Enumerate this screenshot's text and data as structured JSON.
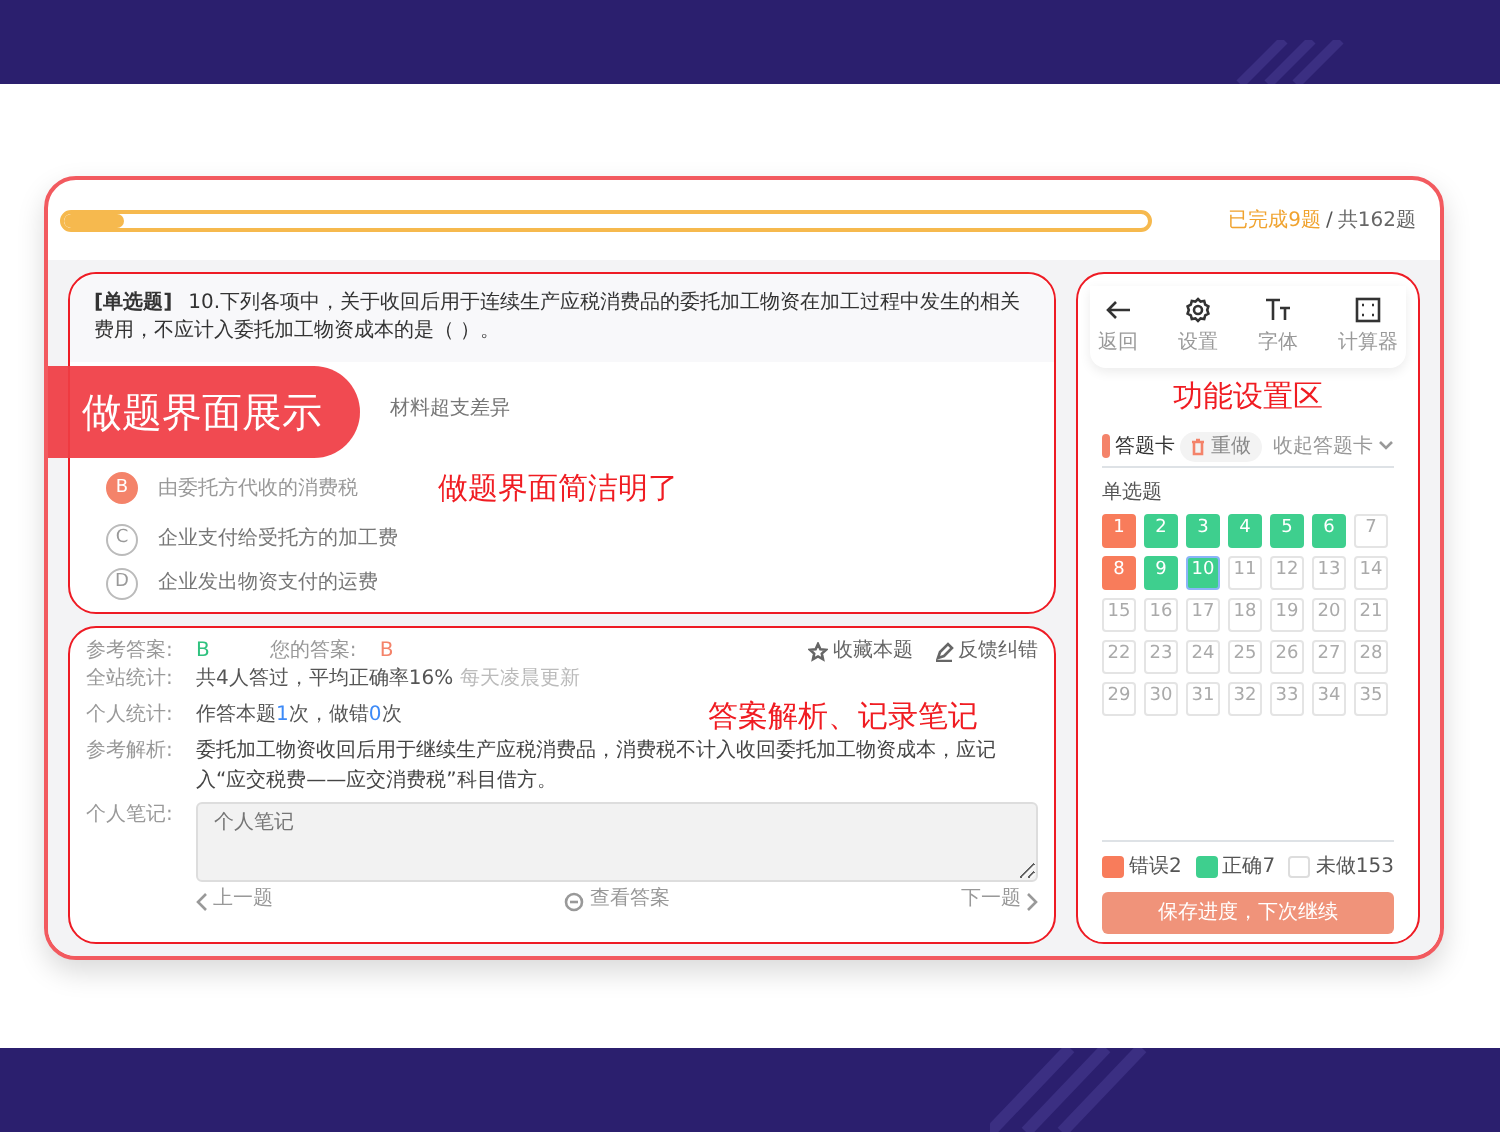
{
  "progress": {
    "level": 0.056,
    "done": "已完成9题",
    "separator": "/",
    "total": "共162题"
  },
  "question": {
    "type": "[单选题]",
    "text": "10.下列各项中，关于收回后用于连续生产应税消费品的委托加工物资在加工过程中发生的相关费用，不应计入委托加工物资成本的是（  ）。",
    "options": [
      {
        "text": "材料超支差异",
        "selected": false
      },
      {
        "letter": "B",
        "text": "由委托方代收的消费税",
        "selected": true
      },
      {
        "letter": "C",
        "text": "企业支付给受托方的加工费",
        "selected": false
      },
      {
        "letter": "D",
        "text": "企业发出物资支付的运费",
        "selected": false
      }
    ]
  },
  "answer": {
    "reference_label": "参考答案:",
    "reference": "B",
    "yours_label": "您的答案:",
    "yours": "B",
    "actions": [
      {
        "label": "收藏本题",
        "kind": "star"
      },
      {
        "label": "反馈纠错",
        "kind": "edit"
      }
    ],
    "site_stats_label": "全站统计:",
    "site_stats": "共4人答过，平均正确率16%",
    "site_stats_note": "每天凌晨更新",
    "personal_stats_label": "个人统计:",
    "personal_stats": [
      {
        "text": "作答本题",
        "highlight": false
      },
      {
        "text": "1",
        "highlight": true
      },
      {
        "text": "次，做错",
        "highlight": false
      },
      {
        "text": "0",
        "highlight": true
      },
      {
        "text": "次",
        "highlight": false
      }
    ],
    "analysis_label": "参考解析:",
    "analysis": "委托加工物资收回后用于继续生产应税消费品，消费税不计入收回委托加工物资成本，应记入“应交税费——应交消费税”科目借方。",
    "notes_label": "个人笔记:",
    "notes_placeholder": "个人笔记",
    "prev": "上一题",
    "show": "查看答案",
    "next": "下一题"
  },
  "tools": [
    {
      "label": "返回",
      "kind": "back"
    },
    {
      "label": "设置",
      "kind": "settings"
    },
    {
      "label": "字体",
      "kind": "font"
    },
    {
      "label": "计算器",
      "kind": "calculator"
    }
  ],
  "card_header": {
    "title": "答题卡",
    "redo": "重做",
    "collapse": "收起答题卡"
  },
  "section": "单选题",
  "cells": [
    {
      "n": "1",
      "kind": "wrong"
    },
    {
      "n": "2",
      "kind": "right"
    },
    {
      "n": "3",
      "kind": "right"
    },
    {
      "n": "4",
      "kind": "right"
    },
    {
      "n": "5",
      "kind": "right"
    },
    {
      "n": "6",
      "kind": "right"
    },
    {
      "n": "7",
      "kind": "undone"
    },
    {
      "n": "8",
      "kind": "wrong"
    },
    {
      "n": "9",
      "kind": "right"
    },
    {
      "n": "10",
      "kind": "current"
    },
    {
      "n": "11",
      "kind": "undone"
    },
    {
      "n": "12",
      "kind": "undone"
    },
    {
      "n": "13",
      "kind": "undone"
    },
    {
      "n": "14",
      "kind": "undone"
    },
    {
      "n": "15",
      "kind": "undone"
    },
    {
      "n": "16",
      "kind": "undone"
    },
    {
      "n": "17",
      "kind": "undone"
    },
    {
      "n": "18",
      "kind": "undone"
    },
    {
      "n": "19",
      "kind": "undone"
    },
    {
      "n": "20",
      "kind": "undone"
    },
    {
      "n": "21",
      "kind": "undone"
    },
    {
      "n": "22",
      "kind": "undone"
    },
    {
      "n": "23",
      "kind": "undone"
    },
    {
      "n": "24",
      "kind": "undone"
    },
    {
      "n": "25",
      "kind": "undone"
    },
    {
      "n": "26",
      "kind": "undone"
    },
    {
      "n": "27",
      "kind": "undone"
    },
    {
      "n": "28",
      "kind": "undone"
    },
    {
      "n": "29",
      "kind": "undone"
    },
    {
      "n": "30",
      "kind": "undone"
    },
    {
      "n": "31",
      "kind": "undone"
    },
    {
      "n": "32",
      "kind": "undone"
    },
    {
      "n": "33",
      "kind": "undone"
    },
    {
      "n": "34",
      "kind": "undone"
    },
    {
      "n": "35",
      "kind": "undone"
    }
  ],
  "legend": [
    {
      "label": "错误2",
      "kind": "wrong"
    },
    {
      "label": "正确7",
      "kind": "right"
    },
    {
      "label": "未做153",
      "kind": "undone"
    }
  ],
  "save": "保存进度，下次继续",
  "annotations": {
    "overlay": "做题界面展示",
    "question": "做题界面简洁明了",
    "answer": "答案解析、记录笔记",
    "tools": "功能设置区"
  }
}
